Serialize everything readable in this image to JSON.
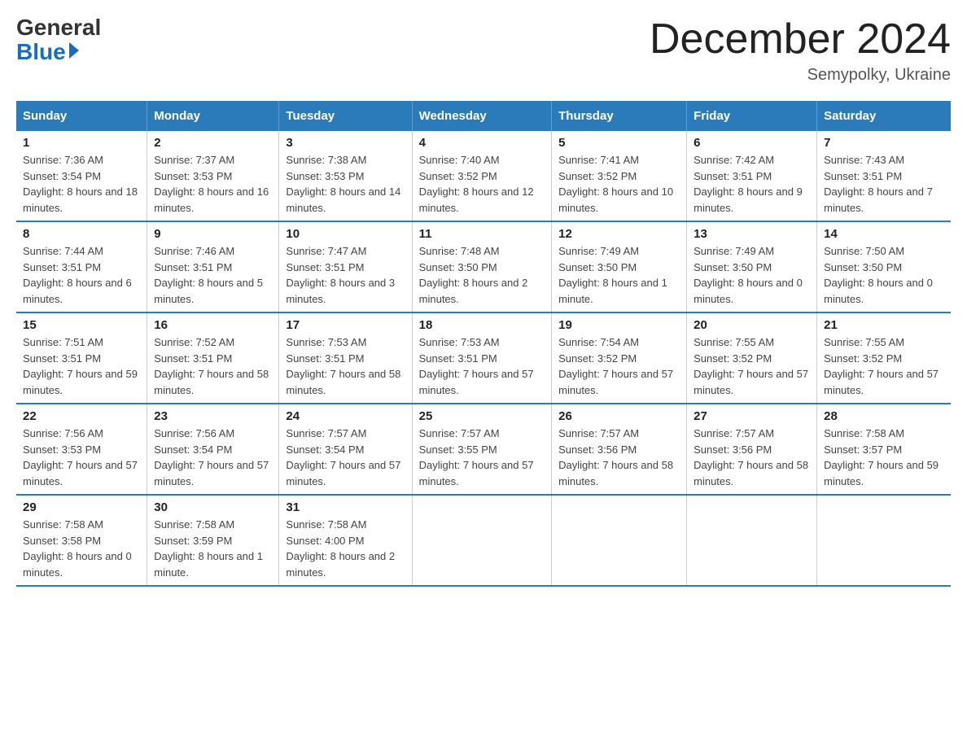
{
  "logo": {
    "general": "General",
    "blue": "Blue"
  },
  "title": "December 2024",
  "subtitle": "Semypolky, Ukraine",
  "headers": [
    "Sunday",
    "Monday",
    "Tuesday",
    "Wednesday",
    "Thursday",
    "Friday",
    "Saturday"
  ],
  "weeks": [
    [
      {
        "day": "1",
        "sunrise": "7:36 AM",
        "sunset": "3:54 PM",
        "daylight": "8 hours and 18 minutes."
      },
      {
        "day": "2",
        "sunrise": "7:37 AM",
        "sunset": "3:53 PM",
        "daylight": "8 hours and 16 minutes."
      },
      {
        "day": "3",
        "sunrise": "7:38 AM",
        "sunset": "3:53 PM",
        "daylight": "8 hours and 14 minutes."
      },
      {
        "day": "4",
        "sunrise": "7:40 AM",
        "sunset": "3:52 PM",
        "daylight": "8 hours and 12 minutes."
      },
      {
        "day": "5",
        "sunrise": "7:41 AM",
        "sunset": "3:52 PM",
        "daylight": "8 hours and 10 minutes."
      },
      {
        "day": "6",
        "sunrise": "7:42 AM",
        "sunset": "3:51 PM",
        "daylight": "8 hours and 9 minutes."
      },
      {
        "day": "7",
        "sunrise": "7:43 AM",
        "sunset": "3:51 PM",
        "daylight": "8 hours and 7 minutes."
      }
    ],
    [
      {
        "day": "8",
        "sunrise": "7:44 AM",
        "sunset": "3:51 PM",
        "daylight": "8 hours and 6 minutes."
      },
      {
        "day": "9",
        "sunrise": "7:46 AM",
        "sunset": "3:51 PM",
        "daylight": "8 hours and 5 minutes."
      },
      {
        "day": "10",
        "sunrise": "7:47 AM",
        "sunset": "3:51 PM",
        "daylight": "8 hours and 3 minutes."
      },
      {
        "day": "11",
        "sunrise": "7:48 AM",
        "sunset": "3:50 PM",
        "daylight": "8 hours and 2 minutes."
      },
      {
        "day": "12",
        "sunrise": "7:49 AM",
        "sunset": "3:50 PM",
        "daylight": "8 hours and 1 minute."
      },
      {
        "day": "13",
        "sunrise": "7:49 AM",
        "sunset": "3:50 PM",
        "daylight": "8 hours and 0 minutes."
      },
      {
        "day": "14",
        "sunrise": "7:50 AM",
        "sunset": "3:50 PM",
        "daylight": "8 hours and 0 minutes."
      }
    ],
    [
      {
        "day": "15",
        "sunrise": "7:51 AM",
        "sunset": "3:51 PM",
        "daylight": "7 hours and 59 minutes."
      },
      {
        "day": "16",
        "sunrise": "7:52 AM",
        "sunset": "3:51 PM",
        "daylight": "7 hours and 58 minutes."
      },
      {
        "day": "17",
        "sunrise": "7:53 AM",
        "sunset": "3:51 PM",
        "daylight": "7 hours and 58 minutes."
      },
      {
        "day": "18",
        "sunrise": "7:53 AM",
        "sunset": "3:51 PM",
        "daylight": "7 hours and 57 minutes."
      },
      {
        "day": "19",
        "sunrise": "7:54 AM",
        "sunset": "3:52 PM",
        "daylight": "7 hours and 57 minutes."
      },
      {
        "day": "20",
        "sunrise": "7:55 AM",
        "sunset": "3:52 PM",
        "daylight": "7 hours and 57 minutes."
      },
      {
        "day": "21",
        "sunrise": "7:55 AM",
        "sunset": "3:52 PM",
        "daylight": "7 hours and 57 minutes."
      }
    ],
    [
      {
        "day": "22",
        "sunrise": "7:56 AM",
        "sunset": "3:53 PM",
        "daylight": "7 hours and 57 minutes."
      },
      {
        "day": "23",
        "sunrise": "7:56 AM",
        "sunset": "3:54 PM",
        "daylight": "7 hours and 57 minutes."
      },
      {
        "day": "24",
        "sunrise": "7:57 AM",
        "sunset": "3:54 PM",
        "daylight": "7 hours and 57 minutes."
      },
      {
        "day": "25",
        "sunrise": "7:57 AM",
        "sunset": "3:55 PM",
        "daylight": "7 hours and 57 minutes."
      },
      {
        "day": "26",
        "sunrise": "7:57 AM",
        "sunset": "3:56 PM",
        "daylight": "7 hours and 58 minutes."
      },
      {
        "day": "27",
        "sunrise": "7:57 AM",
        "sunset": "3:56 PM",
        "daylight": "7 hours and 58 minutes."
      },
      {
        "day": "28",
        "sunrise": "7:58 AM",
        "sunset": "3:57 PM",
        "daylight": "7 hours and 59 minutes."
      }
    ],
    [
      {
        "day": "29",
        "sunrise": "7:58 AM",
        "sunset": "3:58 PM",
        "daylight": "8 hours and 0 minutes."
      },
      {
        "day": "30",
        "sunrise": "7:58 AM",
        "sunset": "3:59 PM",
        "daylight": "8 hours and 1 minute."
      },
      {
        "day": "31",
        "sunrise": "7:58 AM",
        "sunset": "4:00 PM",
        "daylight": "8 hours and 2 minutes."
      },
      null,
      null,
      null,
      null
    ]
  ]
}
